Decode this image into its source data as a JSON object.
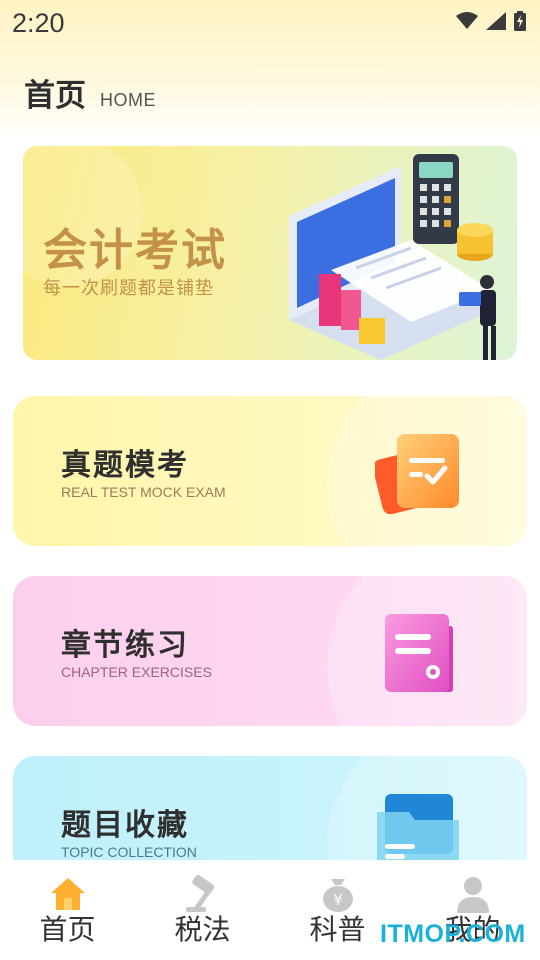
{
  "status_bar": {
    "time": "2:20",
    "icons": [
      "wifi-icon",
      "signal-icon",
      "battery-charging-icon"
    ]
  },
  "header": {
    "title": "首页",
    "subtitle": "HOME"
  },
  "banner": {
    "title": "会计考试",
    "subtitle": "每一次刷题都是铺垫"
  },
  "cards": [
    {
      "title": "真题模考",
      "subtitle": "REAL TEST MOCK EXAM",
      "icon": "exam-paper-icon"
    },
    {
      "title": "章节练习",
      "subtitle": "CHAPTER EXERCISES",
      "icon": "chapter-book-icon"
    },
    {
      "title": "题目收藏",
      "subtitle": "TOPIC COLLECTION",
      "icon": "folder-icon"
    }
  ],
  "bottom_nav": [
    {
      "label": "首页",
      "icon": "home-icon",
      "active": true
    },
    {
      "label": "税法",
      "icon": "gavel-icon",
      "active": false
    },
    {
      "label": "科普",
      "icon": "money-bag-icon",
      "active": false
    },
    {
      "label": "我的",
      "icon": "user-icon",
      "active": false
    }
  ],
  "watermark": "ITMOP.COM",
  "colors": {
    "accent": "#ffb030",
    "banner_text": "#c4914a",
    "watermark": "#1bb2d9"
  }
}
